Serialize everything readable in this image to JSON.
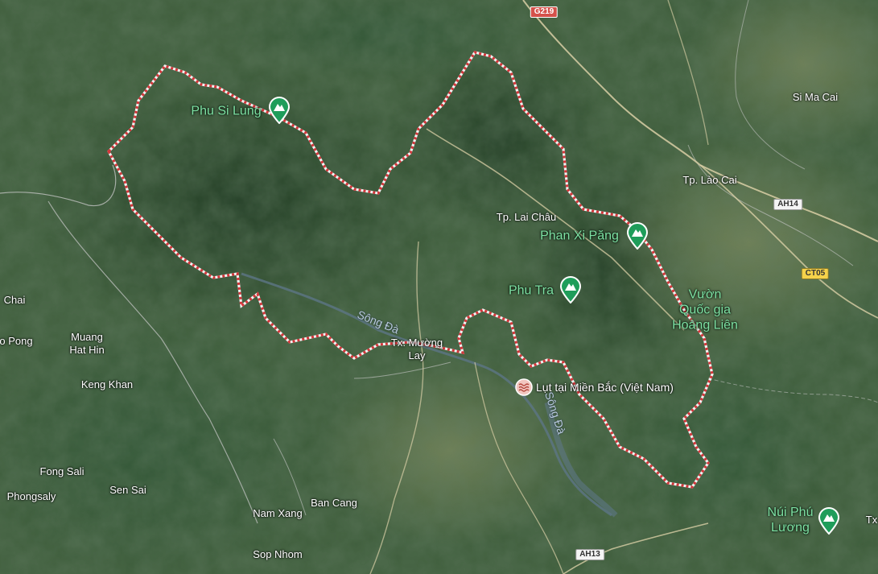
{
  "map": {
    "view": "satellite",
    "region_boundary_style": {
      "outline": "#e8e8e8",
      "dash": "#d3363a"
    },
    "colors": {
      "terrain_dark": "#2a4a2c",
      "terrain_mid": "#3e5d3b",
      "terrain_light": "#6b7a52",
      "water": "#5d7686",
      "road": "#d9cfa6",
      "admin_border": "#c9c9c9",
      "peak_pin": "#1f9d5a"
    }
  },
  "places": {
    "sima_cai": "Si Ma Cai",
    "lao_cai": "Tp. Lào Cai",
    "lai_chau": "Tp. Lai Châu",
    "muong_lay": "Tx. Mường\nLay",
    "chai": "Chai",
    "pong": "o Pong",
    "muang_hat_hin": "Muang\nHat Hin",
    "keng_khan": "Keng Khan",
    "fong_sali": "Fong Sali",
    "phongsaly": "Phongsaly",
    "sen_sai": "Sen Sai",
    "nam_xang": "Nam Xang",
    "ban_cang": "Ban Cang",
    "sop_nhom": "Sop Nhom",
    "tx_edge": "Tx"
  },
  "peaks": {
    "phu_si_lung": "Phu Si Lung",
    "phan_xi_pang": "Phan Xi Păng",
    "phu_tra": "Phu Tra",
    "nui_phu_luong": "Núi Phú\nLương"
  },
  "park": {
    "hoang_lien": "Vườn\nQuốc gia\nHoàng Liên"
  },
  "rivers": {
    "song_da_1": "Sông Đà",
    "song_da_2": "Sông Đà"
  },
  "roads": {
    "g219": "G219",
    "ah14": "AH14",
    "ct05": "CT05",
    "ah13": "AH13"
  },
  "poi": {
    "flood": "Lụt tại Miền Bắc (Việt Nam)",
    "flood_icon": "waves-icon"
  }
}
